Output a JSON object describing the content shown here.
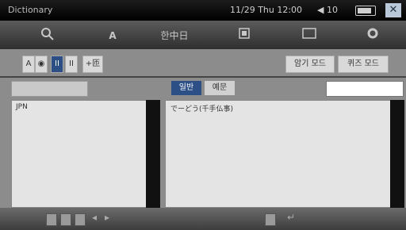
{
  "app": {
    "title": "Dictionary",
    "time": "11/29 Thu 12:00",
    "volume": "◀ 10",
    "close": "✕"
  },
  "toolbar": {
    "search_icon": "search-icon",
    "font_label": "A",
    "hanja_label": "한中日",
    "panel_icon": "panel-icon",
    "window_icon": "window-icon",
    "settings_icon": "gear-icon"
  },
  "subbar": {
    "font_btn": "A",
    "eye_btn": "◉",
    "pause_btn": "II",
    "pause_btn2": "II",
    "plus_btn": "+匝",
    "mode1": "암기 모드",
    "mode2": "퀴즈 모드"
  },
  "left": {
    "list_items": [
      "JPN"
    ]
  },
  "right": {
    "tab1": "일반",
    "tab2": "예문",
    "content": "でーどう(千手仏事)"
  },
  "bottom": {
    "icons": [
      "note-icon",
      "bookmark-icon",
      "edit-icon",
      "back-icon",
      "forward-icon"
    ],
    "right_icons": [
      "lock-icon",
      "undo-icon"
    ]
  }
}
